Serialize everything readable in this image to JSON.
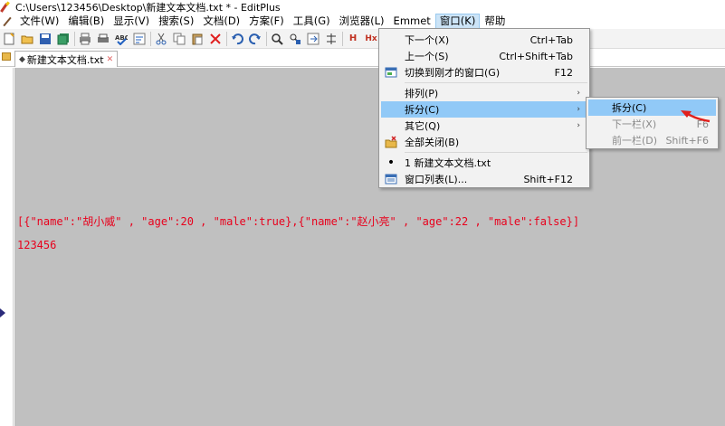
{
  "window": {
    "title": "C:\\Users\\123456\\Desktop\\新建文本文档.txt * - EditPlus"
  },
  "menubar": {
    "items": [
      "文件(W)",
      "编辑(B)",
      "显示(V)",
      "搜索(S)",
      "文档(D)",
      "方案(F)",
      "工具(G)",
      "浏览器(L)",
      "Emmet",
      "窗口(K)",
      "帮助"
    ],
    "active_index": 9
  },
  "toolbar": {
    "icons": [
      "new-file-icon",
      "open-folder-icon",
      "save-icon",
      "save-all-icon",
      "print-icon",
      "print-preview-icon",
      "spellcheck-icon",
      "word-wrap-icon",
      "cut-icon",
      "copy-icon",
      "paste-icon",
      "delete-icon",
      "undo-icon",
      "redo-icon",
      "find-icon",
      "replace-icon",
      "goto-icon",
      "column-icon",
      "heading-icon",
      "hx-icon",
      "hw-icon",
      "list-icon"
    ]
  },
  "tabs": [
    {
      "label": "新建文本文档.txt",
      "modified_marker": "◆",
      "close": "✕"
    }
  ],
  "editor": {
    "lines": [
      "[{\"name\":\"胡小威\" , \"age\":20 , \"male\":true},{\"name\":\"赵小亮\" , \"age\":22 , \"male\":false}]",
      "123456"
    ],
    "text_color": "#e8001c",
    "background": "#c0c0c0"
  },
  "window_menu": {
    "items": [
      {
        "label": "下一个(X)",
        "shortcut": "Ctrl+Tab"
      },
      {
        "label": "上一个(S)",
        "shortcut": "Ctrl+Shift+Tab"
      },
      {
        "label": "切换到刚才的窗口(G)",
        "shortcut": "F12",
        "icon": "switch-window-icon"
      },
      {
        "label": "排列(P)",
        "submenu_arrow": "›"
      },
      {
        "label": "拆分(C)",
        "submenu_arrow": "›"
      },
      {
        "label": "其它(Q)",
        "submenu_arrow": "›"
      },
      {
        "label": "全部关闭(B)",
        "icon": "close-all-icon"
      },
      {
        "label": "1 新建文本文档.txt",
        "bullet": "•"
      },
      {
        "label": "窗口列表(L)...",
        "shortcut": "Shift+F12",
        "icon": "window-list-icon"
      }
    ],
    "hover_index": 4
  },
  "split_submenu": {
    "items": [
      {
        "label": "拆分(C)",
        "shortcut": "",
        "enabled": true
      },
      {
        "label": "下一栏(X)",
        "shortcut": "F6",
        "enabled": false
      },
      {
        "label": "前一栏(D)",
        "shortcut": "Shift+F6",
        "enabled": false
      }
    ],
    "hover_index": 0
  },
  "colors": {
    "menu_hover": "#91c9f7",
    "active_menu_bg": "#cce4f7",
    "annotation_arrow": "#e0201c"
  }
}
